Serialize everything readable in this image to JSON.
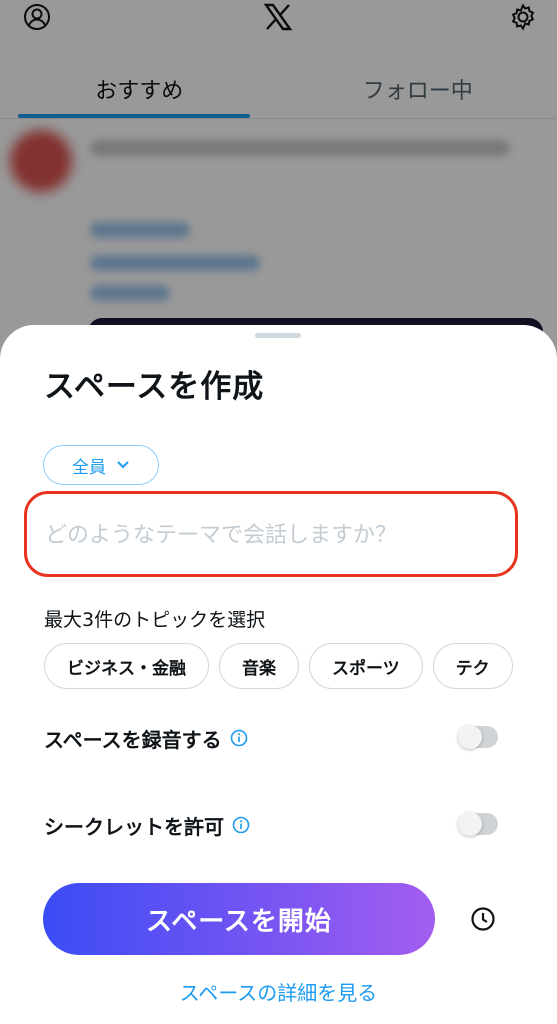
{
  "header": {
    "profile_icon": "profile-icon",
    "logo_icon": "x-logo-icon",
    "settings_icon": "gear-icon"
  },
  "tabs": [
    {
      "label": "おすすめ",
      "active": true
    },
    {
      "label": "フォロー中",
      "active": false
    }
  ],
  "sheet": {
    "title": "スペースを作成",
    "audience": {
      "label": "全員",
      "icon": "chevron-down-icon"
    },
    "topic_input": {
      "value": "",
      "placeholder": "どのようなテーマで会話しますか？"
    },
    "topics_label": "最大3件のトピックを選択",
    "topics": [
      "ビジネス・金融",
      "音楽",
      "スポーツ",
      "テク"
    ],
    "record_toggle": {
      "label": "スペースを録音する",
      "on": false,
      "icon": "info-icon"
    },
    "incognito_toggle": {
      "label": "シークレットを許可",
      "on": false,
      "icon": "info-icon"
    },
    "start_button": "スペースを開始",
    "schedule_icon": "clock-icon",
    "details_link": "スペースの詳細を見る"
  },
  "colors": {
    "accent": "#1d9bf0",
    "highlight_border": "#e8331e",
    "button_gradient_start": "#3b4cf5",
    "button_gradient_end": "#a35ef0"
  }
}
